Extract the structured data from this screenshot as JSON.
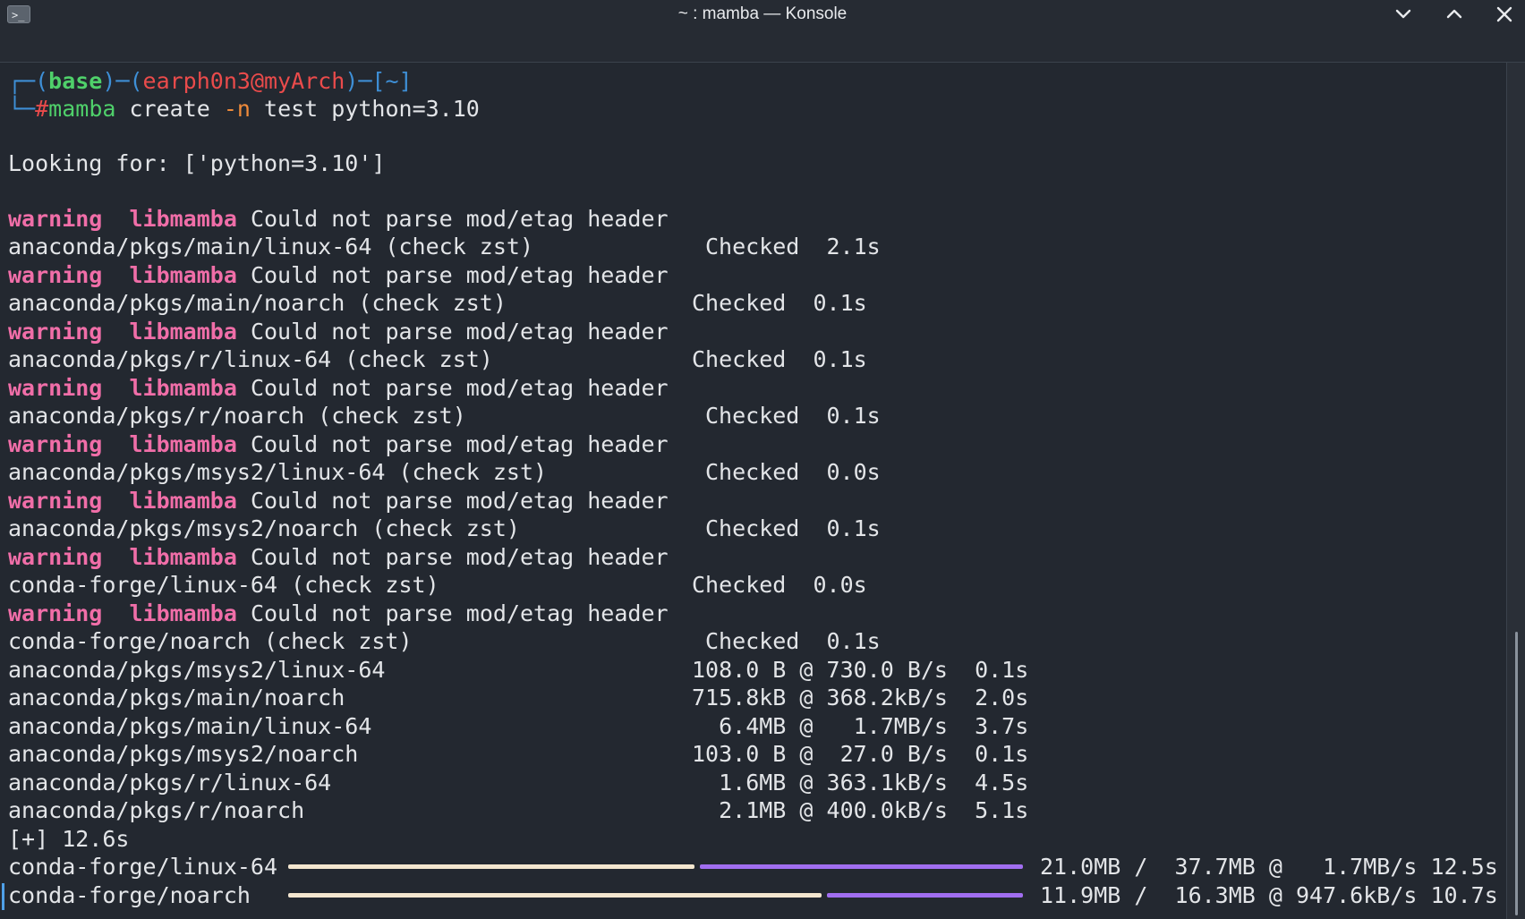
{
  "window": {
    "title": "~ : mamba — Konsole",
    "app_icon_glyph": ">_",
    "icons": [
      "terminal-icon",
      "chevron-down-icon",
      "chevron-up-icon",
      "close-icon"
    ]
  },
  "prompt": {
    "box_top": "┌─(",
    "env": "base",
    "sep1": ")─(",
    "userhost": "earph0n3@myArch",
    "sep2": ")─[",
    "dir": "~",
    "close_bracket": "]",
    "box_bottom": "└─",
    "hash": "#",
    "cmd": "mamba",
    "arg1": " create ",
    "flag": "-n",
    "arg2": " test python=3.10"
  },
  "looking_for": "Looking for: ['python=3.10']",
  "warning_label": "warning",
  "warning_source": "libmamba",
  "warning_message": "Could not parse mod/etag header",
  "checks": [
    {
      "channel": "anaconda/pkgs/main/linux-64 (check zst)",
      "status": "Checked  2.1s"
    },
    {
      "channel": "anaconda/pkgs/main/noarch (check zst)",
      "status": "Checked  0.1s"
    },
    {
      "channel": "anaconda/pkgs/r/linux-64 (check zst)",
      "status": "Checked  0.1s"
    },
    {
      "channel": "anaconda/pkgs/r/noarch (check zst)",
      "status": "Checked  0.1s"
    },
    {
      "channel": "anaconda/pkgs/msys2/linux-64 (check zst)",
      "status": "Checked  0.0s"
    },
    {
      "channel": "anaconda/pkgs/msys2/noarch (check zst)",
      "status": "Checked  0.1s"
    },
    {
      "channel": "conda-forge/linux-64 (check zst)",
      "status": "Checked  0.0s"
    },
    {
      "channel": "conda-forge/noarch (check zst)",
      "status": "Checked  0.1s"
    }
  ],
  "downloads": [
    {
      "channel": "anaconda/pkgs/msys2/linux-64",
      "stats": "108.0 B @ 730.0 B/s  0.1s"
    },
    {
      "channel": "anaconda/pkgs/main/noarch",
      "stats": "715.8kB @ 368.2kB/s  2.0s"
    },
    {
      "channel": "anaconda/pkgs/main/linux-64",
      "stats": "  6.4MB @   1.7MB/s  3.7s"
    },
    {
      "channel": "anaconda/pkgs/msys2/noarch",
      "stats": "103.0 B @  27.0 B/s  0.1s"
    },
    {
      "channel": "anaconda/pkgs/r/linux-64",
      "stats": "  1.6MB @ 363.1kB/s  4.5s"
    },
    {
      "channel": "anaconda/pkgs/r/noarch",
      "stats": "  2.1MB @ 400.0kB/s  5.1s"
    }
  ],
  "summary": "[+] 12.6s",
  "progress": [
    {
      "channel": "conda-forge/linux-64",
      "stats": "21.0MB /  37.7MB @   1.7MB/s 12.5s",
      "fraction": 0.557
    },
    {
      "channel": "conda-forge/noarch",
      "stats": "11.9MB /  16.3MB @ 947.6kB/s 10.7s",
      "fraction": 0.73
    }
  ]
}
